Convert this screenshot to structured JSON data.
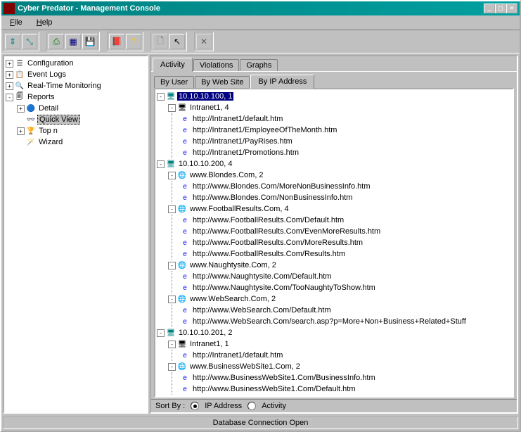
{
  "title": "Cyber Predator - Management Console",
  "menu": {
    "file": "File",
    "help": "Help"
  },
  "nav": {
    "config": "Configuration",
    "eventlogs": "Event Logs",
    "monitoring": "Real-Time Monitoring",
    "reports": "Reports",
    "detail": "Detail",
    "quickview": "Quick View",
    "topn": "Top n",
    "wizard": "Wizard"
  },
  "tabs": {
    "activity": "Activity",
    "violations": "Violations",
    "graphs": "Graphs"
  },
  "subtabs": {
    "byuser": "By User",
    "bywebsite": "By Web Site",
    "byip": "By IP Address"
  },
  "sort": {
    "label": "Sort By :",
    "opt1": "IP Address",
    "opt2": "Activity"
  },
  "status": "Database Connection Open",
  "tree": [
    {
      "ip": "10.10.10.100, 1",
      "highlighted": true,
      "sites": [
        {
          "name": "Intranet1, 4",
          "globe": false,
          "urls": [
            "http://Intranet1/default.htm",
            "http://Intranet1/EmployeeOfTheMonth.htm",
            "http://Intranet1/PayRises.htm",
            "http://Intranet1/Promotions.htm"
          ]
        }
      ]
    },
    {
      "ip": "10.10.10.200, 4",
      "sites": [
        {
          "name": "www.Blondes.Com, 2",
          "globe": true,
          "urls": [
            "http://www.Blondes.Com/MoreNonBusinessInfo.htm",
            "http://www.Blondes.Com/NonBusinessInfo.htm"
          ]
        },
        {
          "name": "www.FootballResults.Com, 4",
          "globe": true,
          "urls": [
            "http://www.FootballResults.Com/Default.htm",
            "http://www.FootballResults.Com/EvenMoreResults.htm",
            "http://www.FootballResults.Com/MoreResults.htm",
            "http://www.FootballResults.Com/Results.htm"
          ]
        },
        {
          "name": "www.Naughtysite.Com, 2",
          "globe": true,
          "urls": [
            "http://www.Naughtysite.Com/Default.htm",
            "http://www.Naughtysite.Com/TooNaughtyToShow.htm"
          ]
        },
        {
          "name": "www.WebSearch.Com, 2",
          "globe": true,
          "urls": [
            "http://www.WebSearch.Com/Default.htm",
            "http://www.WebSearch.Com/search.asp?p=More+Non+Business+Related+Stuff"
          ]
        }
      ]
    },
    {
      "ip": "10.10.10.201, 2",
      "sites": [
        {
          "name": "Intranet1, 1",
          "globe": false,
          "urls": [
            "http://Intranet1/default.htm"
          ]
        },
        {
          "name": "www.BusinessWebSite1.Com, 2",
          "globe": true,
          "urls": [
            "http://www.BusinessWebSite1.Com/BusinessInfo.htm",
            "http://www.BusinessWebSite1.Com/Default.htm"
          ]
        }
      ]
    }
  ]
}
